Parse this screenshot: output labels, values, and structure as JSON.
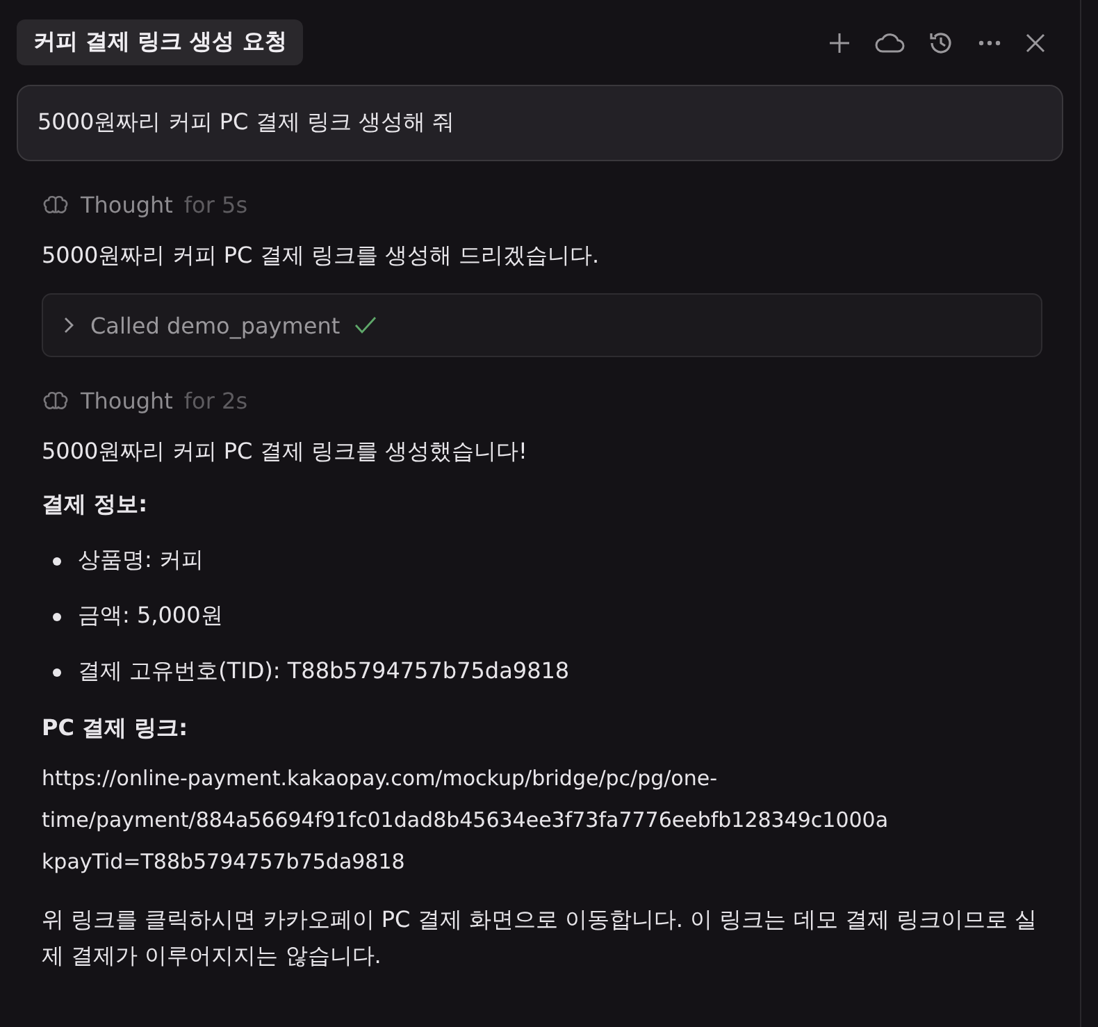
{
  "title": "커피 결제 링크 생성 요청",
  "prompt": "5000원짜리 커피 PC 결제 링크 생성해 줘",
  "messages": [
    {
      "kind": "thought",
      "label": "Thought",
      "duration": "for 5s"
    },
    {
      "kind": "text",
      "text": "5000원짜리 커피 PC 결제 링크를 생성해 드리겠습니다."
    },
    {
      "kind": "tool",
      "label": "Called demo_payment",
      "expanded": false,
      "done": true
    },
    {
      "kind": "thought",
      "label": "Thought",
      "duration": "for 2s"
    },
    {
      "kind": "text",
      "text": "5000원짜리 커피 PC 결제 링크를 생성했습니다!"
    },
    {
      "kind": "heading",
      "text": "결제 정보:"
    },
    {
      "kind": "bullets",
      "items": [
        "상품명: 커피",
        "금액: 5,000원",
        "결제 고유번호(TID): T88b5794757b75da9818"
      ]
    },
    {
      "kind": "heading",
      "text": "PC 결제 링크:"
    },
    {
      "kind": "link",
      "lines": [
        "https://online-payment.kakaopay.com/mockup/bridge/pc/pg/one-",
        "time/payment/884a56694f91fc01dad8b45634ee3f73fa7776eebfb128349c1000a",
        "kpayTid=T88b5794757b75da9818"
      ]
    },
    {
      "kind": "text",
      "text": "위 링크를 클릭하시면 카카오페이 PC 결제 화면으로 이동합니다. 이 링크는 데모 결제 링크이므로 실제 결제가 이루어지지는 않습니다."
    }
  ]
}
